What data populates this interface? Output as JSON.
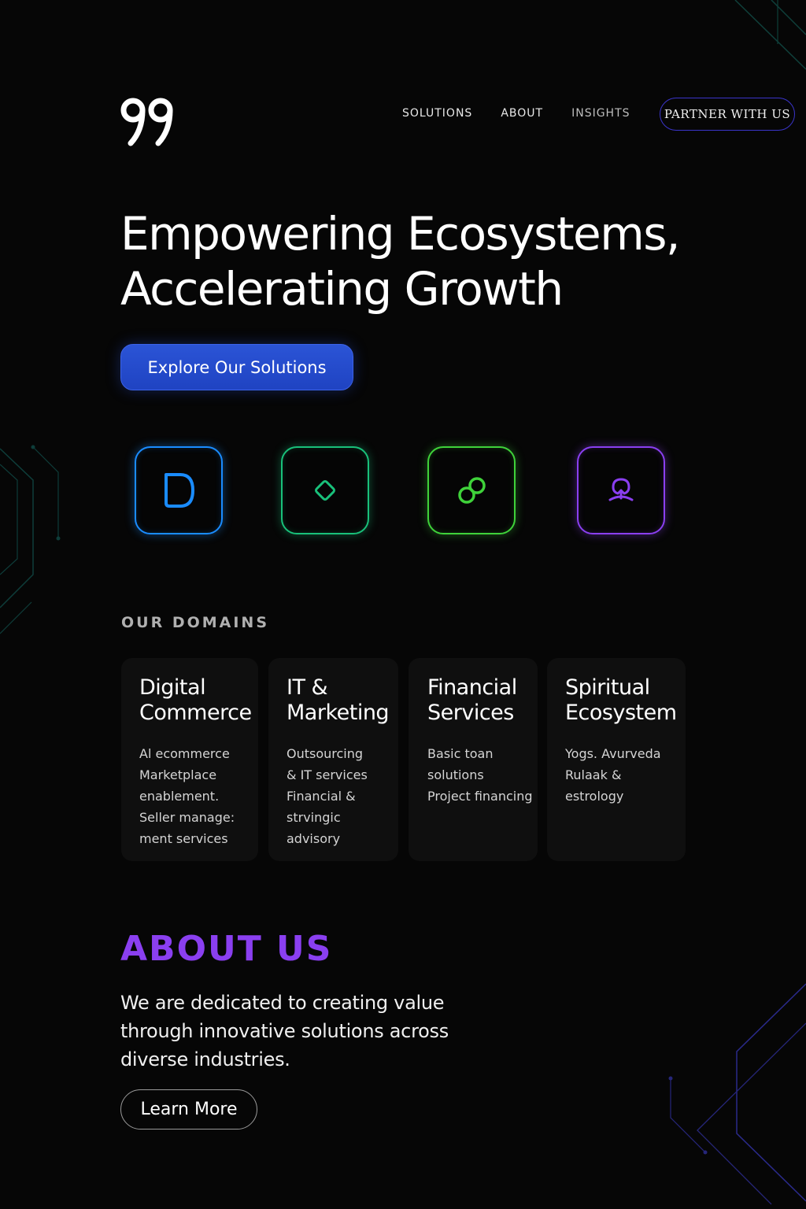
{
  "brand": {
    "logo_text": "99"
  },
  "nav": {
    "links": [
      "SOLUTIONS",
      "ABOUT",
      "INSIGHTS"
    ],
    "partner_label": "PARTNER WITH US"
  },
  "hero": {
    "title_line1": "Empowering Ecosystems,",
    "title_line2": "Accelerating Growth",
    "cta_label": "Explore Our Solutions"
  },
  "icons": [
    {
      "name": "d-shape-icon",
      "color": "#1a8cff"
    },
    {
      "name": "diamond-icon",
      "color": "#19c07a"
    },
    {
      "name": "link-rings-icon",
      "color": "#3fd23a"
    },
    {
      "name": "lotus-icon",
      "color": "#8a3ff0"
    }
  ],
  "domains": {
    "label": "OUR DOMAINS",
    "cards": [
      {
        "title": [
          "Digital",
          "Commerce"
        ],
        "desc": [
          "Al ecommerce",
          "Marketplace",
          "enablement.",
          "Seller manage:",
          "ment services"
        ]
      },
      {
        "title": [
          "IT &",
          "Marketing"
        ],
        "desc": [
          "Outsourcing",
          "& IT services",
          "Financial &",
          "strvingic",
          "advisory"
        ]
      },
      {
        "title": [
          "Financial",
          "Services"
        ],
        "desc": [
          "Basic toan",
          "solutions",
          "Project financing"
        ]
      },
      {
        "title": [
          "Spiritual",
          "Ecosystem"
        ],
        "desc": [
          "Yogs. Avurveda",
          "Rulaak &",
          "estrology"
        ]
      }
    ]
  },
  "about": {
    "title": "ABOUT US",
    "text": [
      "We are dedicated to creating value",
      "through innovative solutions across",
      "diverse industries."
    ],
    "button_label": "Learn More"
  }
}
